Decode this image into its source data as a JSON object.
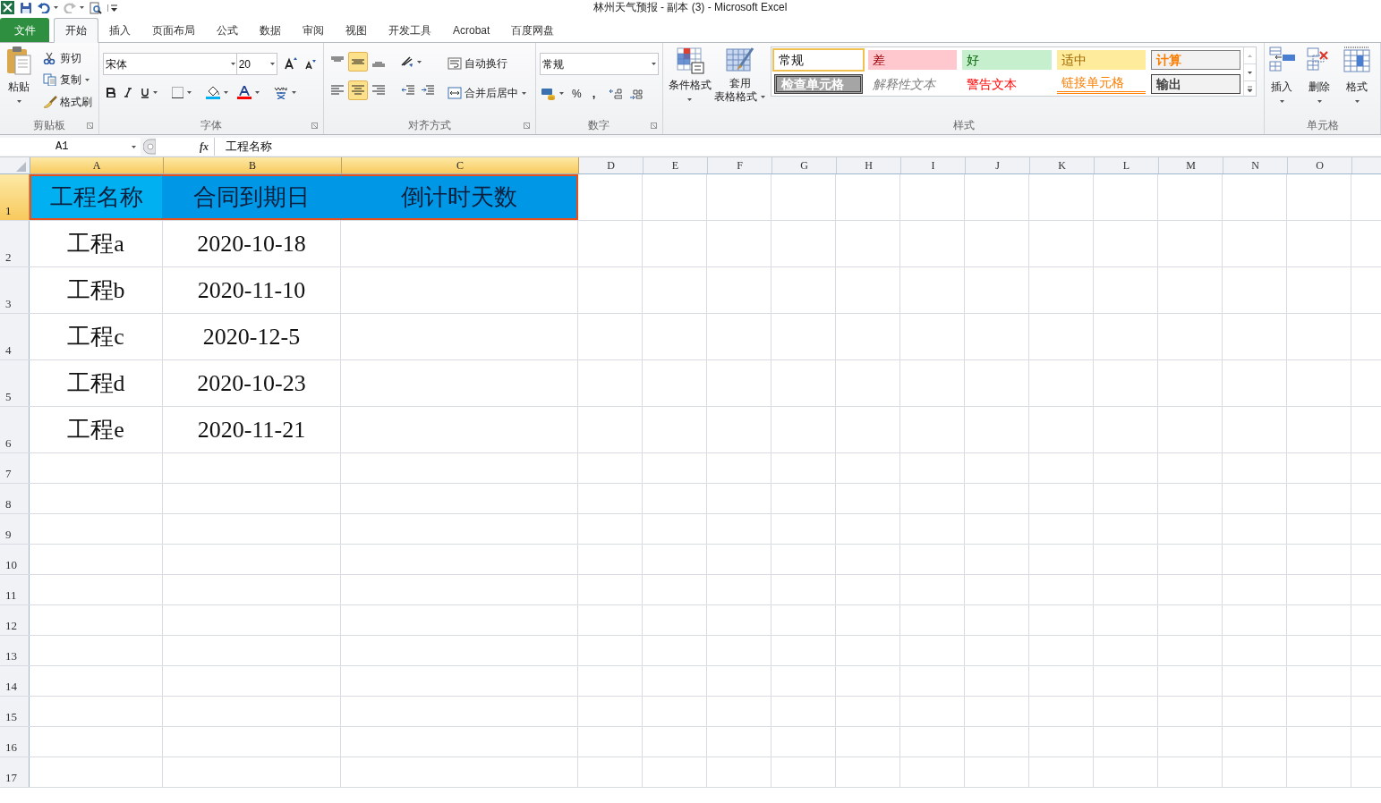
{
  "window": {
    "title": "林州天气预报 - 副本 (3) -  Microsoft Excel"
  },
  "tabs": [
    {
      "label": "文件",
      "kind": "file",
      "selected": false
    },
    {
      "label": "开始",
      "kind": "tab",
      "selected": true
    },
    {
      "label": "插入",
      "kind": "tab",
      "selected": false
    },
    {
      "label": "页面布局",
      "kind": "tab",
      "selected": false
    },
    {
      "label": "公式",
      "kind": "tab",
      "selected": false
    },
    {
      "label": "数据",
      "kind": "tab",
      "selected": false
    },
    {
      "label": "审阅",
      "kind": "tab",
      "selected": false
    },
    {
      "label": "视图",
      "kind": "tab",
      "selected": false
    },
    {
      "label": "开发工具",
      "kind": "tab",
      "selected": false
    },
    {
      "label": "Acrobat",
      "kind": "tab",
      "selected": false
    },
    {
      "label": "百度网盘",
      "kind": "tab",
      "selected": false
    }
  ],
  "ribbon": {
    "clipboard": {
      "label": "剪贴板",
      "paste": "粘贴",
      "cut": "剪切",
      "copy": "复制",
      "format_painter": "格式刷"
    },
    "font": {
      "label": "字体",
      "font_name": "宋体",
      "font_size": "20"
    },
    "alignment": {
      "label": "对齐方式",
      "wrap_text": "自动换行",
      "merge_center": "合并后居中",
      "vertical": [
        {
          "selected": false
        },
        {
          "selected": true
        },
        {
          "selected": false
        }
      ],
      "horizontal": [
        {
          "selected": false
        },
        {
          "selected": true
        },
        {
          "selected": false
        }
      ]
    },
    "number": {
      "label": "数字",
      "format": "常规",
      "percent": "%",
      "comma": ","
    },
    "styles": {
      "label": "样式",
      "conditional_formatting": "条件格式",
      "format_as_table_1": "套用",
      "format_as_table_2": "表格格式",
      "cell_styles": [
        {
          "label": "常规",
          "kind": "normal",
          "selected": true
        },
        {
          "label": "差",
          "kind": "bad",
          "selected": false
        },
        {
          "label": "好",
          "kind": "good",
          "selected": false
        },
        {
          "label": "适中",
          "kind": "neutral",
          "selected": false
        },
        {
          "label": "计算",
          "kind": "calculation",
          "selected": false
        },
        {
          "label": "检查单元格",
          "kind": "check",
          "selected": false
        },
        {
          "label": "解释性文本",
          "kind": "explanatory",
          "selected": false
        },
        {
          "label": "警告文本",
          "kind": "warning",
          "selected": false
        },
        {
          "label": "链接单元格",
          "kind": "linked",
          "selected": false
        },
        {
          "label": "输出",
          "kind": "output",
          "selected": false
        }
      ]
    },
    "cells": {
      "label": "单元格",
      "insert": "插入",
      "delete": "删除",
      "format": "格式"
    }
  },
  "formula_bar": {
    "name_box": "A1",
    "fx": "fx",
    "formula": "工程名称"
  },
  "columns": [
    {
      "label": "A",
      "selected": true
    },
    {
      "label": "B",
      "selected": true
    },
    {
      "label": "C",
      "selected": true
    },
    {
      "label": "D",
      "selected": false
    },
    {
      "label": "E",
      "selected": false
    },
    {
      "label": "F",
      "selected": false
    },
    {
      "label": "G",
      "selected": false
    },
    {
      "label": "H",
      "selected": false
    },
    {
      "label": "I",
      "selected": false
    },
    {
      "label": "J",
      "selected": false
    },
    {
      "label": "K",
      "selected": false
    },
    {
      "label": "L",
      "selected": false
    },
    {
      "label": "M",
      "selected": false
    },
    {
      "label": "N",
      "selected": false
    },
    {
      "label": "O",
      "selected": false
    }
  ],
  "rows": [
    {
      "number": "1",
      "selected": true,
      "kind": "header",
      "cells": [
        {
          "value": "工程名称",
          "selected": true
        },
        {
          "value": "合同到期日",
          "selected": true
        },
        {
          "value": "倒计时天数",
          "selected": true
        }
      ]
    },
    {
      "number": "2",
      "selected": false,
      "kind": "data",
      "cells": [
        {
          "value": "工程a",
          "selected": false
        },
        {
          "value": "2020-10-18",
          "selected": false
        }
      ]
    },
    {
      "number": "3",
      "selected": false,
      "kind": "data",
      "cells": [
        {
          "value": "工程b",
          "selected": false
        },
        {
          "value": "2020-11-10",
          "selected": false
        }
      ]
    },
    {
      "number": "4",
      "selected": false,
      "kind": "data",
      "cells": [
        {
          "value": "工程c",
          "selected": false
        },
        {
          "value": "2020-12-5",
          "selected": false
        }
      ]
    },
    {
      "number": "5",
      "selected": false,
      "kind": "data",
      "cells": [
        {
          "value": "工程d",
          "selected": false
        },
        {
          "value": "2020-10-23",
          "selected": false
        }
      ]
    },
    {
      "number": "6",
      "selected": false,
      "kind": "data",
      "cells": [
        {
          "value": "工程e",
          "selected": false
        },
        {
          "value": "2020-11-21",
          "selected": false
        }
      ]
    },
    {
      "number": "7",
      "selected": false,
      "kind": "empty"
    },
    {
      "number": "8",
      "selected": false,
      "kind": "empty"
    },
    {
      "number": "9",
      "selected": false,
      "kind": "empty"
    },
    {
      "number": "10",
      "selected": false,
      "kind": "empty"
    },
    {
      "number": "11",
      "selected": false,
      "kind": "empty"
    },
    {
      "number": "12",
      "selected": false,
      "kind": "empty"
    },
    {
      "number": "13",
      "selected": false,
      "kind": "empty"
    },
    {
      "number": "14",
      "selected": false,
      "kind": "empty"
    },
    {
      "number": "15",
      "selected": false,
      "kind": "empty"
    },
    {
      "number": "16",
      "selected": false,
      "kind": "empty"
    },
    {
      "number": "17",
      "selected": false,
      "kind": "empty"
    }
  ]
}
